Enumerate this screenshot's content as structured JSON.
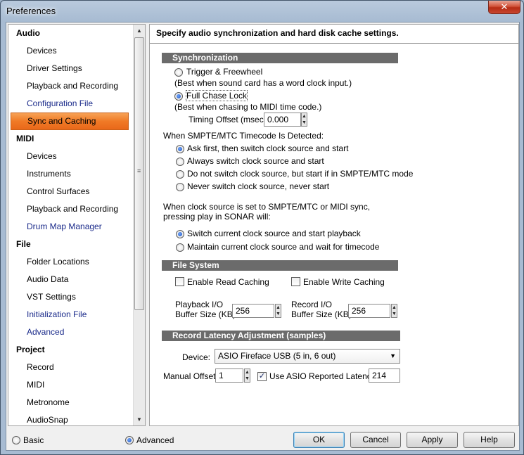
{
  "window": {
    "title": "Preferences",
    "close": "✕"
  },
  "sidebar": {
    "audio": {
      "label": "Audio",
      "items": [
        "Devices",
        "Driver Settings",
        "Playback and Recording",
        "Configuration File",
        "Sync and Caching"
      ]
    },
    "midi": {
      "label": "MIDI",
      "items": [
        "Devices",
        "Instruments",
        "Control Surfaces",
        "Playback and Recording",
        "Drum Map Manager"
      ]
    },
    "file": {
      "label": "File",
      "items": [
        "Folder Locations",
        "Audio Data",
        "VST Settings",
        "Initialization File",
        "Advanced"
      ]
    },
    "project": {
      "label": "Project",
      "items": [
        "Record",
        "MIDI",
        "Metronome",
        "AudioSnap"
      ]
    },
    "selected": "Sync and Caching",
    "accent_color": "#f07a26"
  },
  "panel": {
    "header": "Specify audio synchronization and hard disk cache settings.",
    "sync": {
      "title": "Synchronization",
      "trigger_label": "Trigger & Freewheel",
      "trigger_note": "(Best when sound card has a word clock input.)",
      "chase_label": "Full Chase Lock",
      "chase_note": "(Best when chasing to MIDI time code.)",
      "offset_label": "Timing Offset (msec):",
      "offset_value": "0.000",
      "smpte_heading": "When SMPTE/MTC Timecode Is Detected:",
      "smpte_options": [
        "Ask first, then switch clock source and start",
        "Always switch clock source and start",
        "Do not switch clock source, but start if in SMPTE/MTC mode",
        "Never switch clock source, never start"
      ],
      "play_heading_1": "When clock source is set to SMPTE/MTC or MIDI sync,",
      "play_heading_2": "pressing play in SONAR will:",
      "play_options": [
        "Switch current clock source and start playback",
        "Maintain current clock source and wait for timecode"
      ]
    },
    "filesystem": {
      "title": "File System",
      "read_cache": "Enable Read Caching",
      "write_cache": "Enable Write Caching",
      "playback_label_1": "Playback I/O",
      "playback_label_2": "Buffer Size (KB):",
      "playback_value": "256",
      "record_label_1": "Record I/O",
      "record_label_2": "Buffer Size (KB):",
      "record_value": "256"
    },
    "latency": {
      "title": "Record Latency Adjustment (samples)",
      "device_label": "Device:",
      "device_value": "ASIO Fireface USB (5 in, 6 out)",
      "manual_label": "Manual Offset:",
      "manual_value": "1",
      "asio_label": "Use ASIO Reported Latency:",
      "asio_value": "214"
    }
  },
  "footer": {
    "basic": "Basic",
    "advanced": "Advanced",
    "ok": "OK",
    "cancel": "Cancel",
    "apply": "Apply",
    "help": "Help"
  }
}
